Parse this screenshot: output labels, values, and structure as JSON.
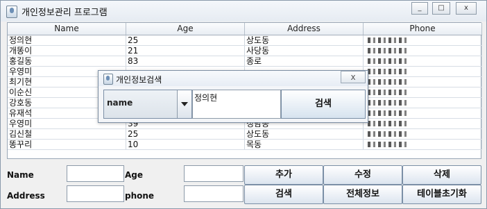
{
  "window": {
    "title": "개인정보관리 프로그램",
    "controls": {
      "minimize": "_",
      "maximize": "□",
      "close": "x"
    }
  },
  "table": {
    "columns": [
      "Name",
      "Age",
      "Address",
      "Phone"
    ],
    "rows": [
      {
        "name": "정의현",
        "age": "25",
        "address": "상도동"
      },
      {
        "name": "개똥이",
        "age": "21",
        "address": "사당동"
      },
      {
        "name": "홍길동",
        "age": "83",
        "address": "종로"
      },
      {
        "name": "우영미",
        "age": "",
        "address": ""
      },
      {
        "name": "최기현",
        "age": "",
        "address": ""
      },
      {
        "name": "이순신",
        "age": "",
        "address": ""
      },
      {
        "name": "강호동",
        "age": "",
        "address": ""
      },
      {
        "name": "유재석",
        "age": "",
        "address": ""
      },
      {
        "name": "우영미",
        "age": "39",
        "address": "청담동"
      },
      {
        "name": "김신철",
        "age": "25",
        "address": "상도동"
      },
      {
        "name": "똥꾸리",
        "age": "10",
        "address": "목동"
      }
    ]
  },
  "form": {
    "name_label": "Name",
    "age_label": "Age",
    "address_label": "Address",
    "phone_label": "phone",
    "name_value": "",
    "age_value": "",
    "address_value": "",
    "phone_value": ""
  },
  "buttons": {
    "add": "추가",
    "edit": "수정",
    "delete": "삭제",
    "search": "검색",
    "all_info": "전체정보",
    "reset_table": "테이블초기화"
  },
  "dialog": {
    "title": "개인정보검색",
    "close": "x",
    "field_select": "name",
    "search_value": "정의현",
    "search_button": "검색"
  }
}
